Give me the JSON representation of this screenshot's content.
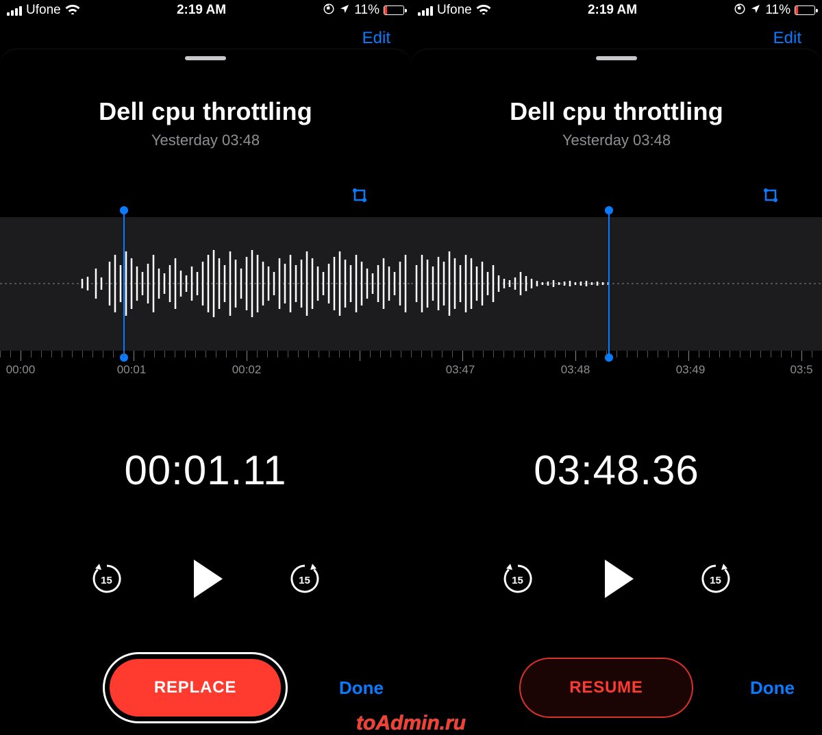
{
  "status": {
    "carrier": "Ufone",
    "time": "2:19 AM",
    "battery_pct": "11%"
  },
  "edit_label": "Edit",
  "recording": {
    "title": "Dell cpu throttling",
    "subtitle": "Yesterday  03:48"
  },
  "colors": {
    "accent_blue": "#0a7bff",
    "accent_red": "#ff3b30"
  },
  "skip_seconds": "15",
  "done_label": "Done",
  "left": {
    "ticks": [
      "00:00",
      "00:01",
      "00:02"
    ],
    "playhead_pct": 30,
    "big_time": "00:01.11",
    "button_label": "REPLACE",
    "button_style": "replace"
  },
  "right": {
    "ticks": [
      "03:47",
      "03:48",
      "03:49",
      "03:5"
    ],
    "playhead_pct": 48,
    "big_time": "03:48.36",
    "button_label": "RESUME",
    "button_style": "resume"
  },
  "watermark": "toAdmin.ru"
}
